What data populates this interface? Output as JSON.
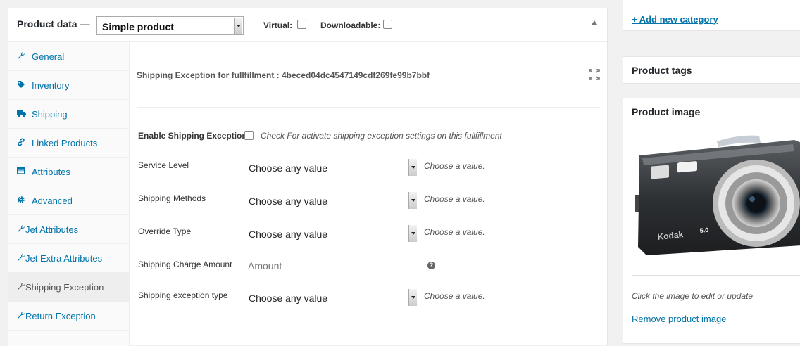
{
  "product_data": {
    "title": "Product data —",
    "type_selected": "Simple product",
    "virtual_label": "Virtual:",
    "downloadable_label": "Downloadable:"
  },
  "tabs": [
    {
      "label": "General",
      "icon": "wrench-icon"
    },
    {
      "label": "Inventory",
      "icon": "tag-icon"
    },
    {
      "label": "Shipping",
      "icon": "truck-icon"
    },
    {
      "label": "Linked Products",
      "icon": "link-icon"
    },
    {
      "label": "Attributes",
      "icon": "list-icon"
    },
    {
      "label": "Advanced",
      "icon": "gear-icon"
    },
    {
      "label": "Jet Attributes",
      "icon": "wrench-icon"
    },
    {
      "label": "Jet Extra Attributes",
      "icon": "wrench-icon"
    },
    {
      "label": "Shipping Exception",
      "icon": "wrench-icon",
      "active": true
    },
    {
      "label": "Return Exception",
      "icon": "wrench-icon"
    }
  ],
  "panel": {
    "title": "Shipping Exception for fullfillment : 4beced04dc4547149cdf269fe99b7bbf",
    "enable_label": "Enable Shipping Exception",
    "enable_hint": "Check For activate shipping exception settings on this fullfillment",
    "fields": {
      "service_level": {
        "label": "Service Level",
        "value": "Choose any value",
        "hint": "Choose a value."
      },
      "shipping_methods": {
        "label": "Shipping Methods",
        "value": "Choose any value",
        "hint": "Choose a value."
      },
      "override_type": {
        "label": "Override Type",
        "value": "Choose any value",
        "hint": "Choose a value."
      },
      "charge_amount": {
        "label": "Shipping Charge Amount",
        "placeholder": "Amount",
        "help": "?"
      },
      "exception_type": {
        "label": "Shipping exception type",
        "value": "Choose any value",
        "hint": "Choose a value."
      }
    }
  },
  "sidebar": {
    "add_category": "+ Add new category",
    "tags_title": "Product tags",
    "image_title": "Product image",
    "image_hint": "Click the image to edit or update",
    "remove_image": "Remove product image",
    "camera_brand": "Kodak",
    "camera_mp": "5.0"
  },
  "colors": {
    "link": "#0073aa",
    "active_tab_bg": "#eeeeee"
  }
}
